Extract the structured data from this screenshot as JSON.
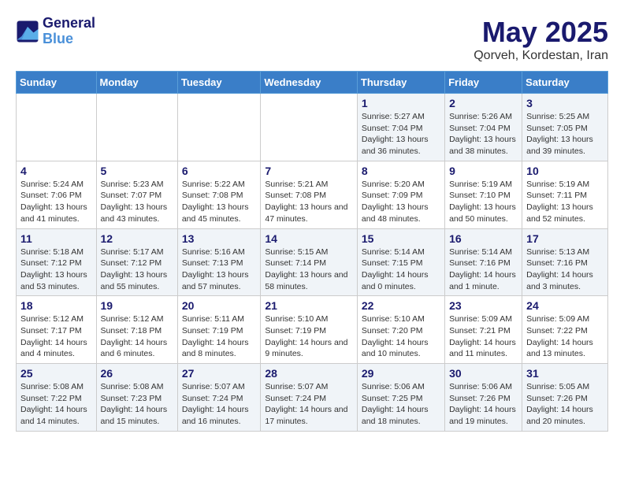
{
  "header": {
    "logo_line1": "General",
    "logo_line2": "Blue",
    "month": "May 2025",
    "location": "Qorveh, Kordestan, Iran"
  },
  "weekdays": [
    "Sunday",
    "Monday",
    "Tuesday",
    "Wednesday",
    "Thursday",
    "Friday",
    "Saturday"
  ],
  "weeks": [
    [
      {
        "day": "",
        "info": ""
      },
      {
        "day": "",
        "info": ""
      },
      {
        "day": "",
        "info": ""
      },
      {
        "day": "",
        "info": ""
      },
      {
        "day": "1",
        "info": "Sunrise: 5:27 AM\nSunset: 7:04 PM\nDaylight: 13 hours\nand 36 minutes."
      },
      {
        "day": "2",
        "info": "Sunrise: 5:26 AM\nSunset: 7:04 PM\nDaylight: 13 hours\nand 38 minutes."
      },
      {
        "day": "3",
        "info": "Sunrise: 5:25 AM\nSunset: 7:05 PM\nDaylight: 13 hours\nand 39 minutes."
      }
    ],
    [
      {
        "day": "4",
        "info": "Sunrise: 5:24 AM\nSunset: 7:06 PM\nDaylight: 13 hours\nand 41 minutes."
      },
      {
        "day": "5",
        "info": "Sunrise: 5:23 AM\nSunset: 7:07 PM\nDaylight: 13 hours\nand 43 minutes."
      },
      {
        "day": "6",
        "info": "Sunrise: 5:22 AM\nSunset: 7:08 PM\nDaylight: 13 hours\nand 45 minutes."
      },
      {
        "day": "7",
        "info": "Sunrise: 5:21 AM\nSunset: 7:08 PM\nDaylight: 13 hours\nand 47 minutes."
      },
      {
        "day": "8",
        "info": "Sunrise: 5:20 AM\nSunset: 7:09 PM\nDaylight: 13 hours\nand 48 minutes."
      },
      {
        "day": "9",
        "info": "Sunrise: 5:19 AM\nSunset: 7:10 PM\nDaylight: 13 hours\nand 50 minutes."
      },
      {
        "day": "10",
        "info": "Sunrise: 5:19 AM\nSunset: 7:11 PM\nDaylight: 13 hours\nand 52 minutes."
      }
    ],
    [
      {
        "day": "11",
        "info": "Sunrise: 5:18 AM\nSunset: 7:12 PM\nDaylight: 13 hours\nand 53 minutes."
      },
      {
        "day": "12",
        "info": "Sunrise: 5:17 AM\nSunset: 7:12 PM\nDaylight: 13 hours\nand 55 minutes."
      },
      {
        "day": "13",
        "info": "Sunrise: 5:16 AM\nSunset: 7:13 PM\nDaylight: 13 hours\nand 57 minutes."
      },
      {
        "day": "14",
        "info": "Sunrise: 5:15 AM\nSunset: 7:14 PM\nDaylight: 13 hours\nand 58 minutes."
      },
      {
        "day": "15",
        "info": "Sunrise: 5:14 AM\nSunset: 7:15 PM\nDaylight: 14 hours\nand 0 minutes."
      },
      {
        "day": "16",
        "info": "Sunrise: 5:14 AM\nSunset: 7:16 PM\nDaylight: 14 hours\nand 1 minute."
      },
      {
        "day": "17",
        "info": "Sunrise: 5:13 AM\nSunset: 7:16 PM\nDaylight: 14 hours\nand 3 minutes."
      }
    ],
    [
      {
        "day": "18",
        "info": "Sunrise: 5:12 AM\nSunset: 7:17 PM\nDaylight: 14 hours\nand 4 minutes."
      },
      {
        "day": "19",
        "info": "Sunrise: 5:12 AM\nSunset: 7:18 PM\nDaylight: 14 hours\nand 6 minutes."
      },
      {
        "day": "20",
        "info": "Sunrise: 5:11 AM\nSunset: 7:19 PM\nDaylight: 14 hours\nand 8 minutes."
      },
      {
        "day": "21",
        "info": "Sunrise: 5:10 AM\nSunset: 7:19 PM\nDaylight: 14 hours\nand 9 minutes."
      },
      {
        "day": "22",
        "info": "Sunrise: 5:10 AM\nSunset: 7:20 PM\nDaylight: 14 hours\nand 10 minutes."
      },
      {
        "day": "23",
        "info": "Sunrise: 5:09 AM\nSunset: 7:21 PM\nDaylight: 14 hours\nand 11 minutes."
      },
      {
        "day": "24",
        "info": "Sunrise: 5:09 AM\nSunset: 7:22 PM\nDaylight: 14 hours\nand 13 minutes."
      }
    ],
    [
      {
        "day": "25",
        "info": "Sunrise: 5:08 AM\nSunset: 7:22 PM\nDaylight: 14 hours\nand 14 minutes."
      },
      {
        "day": "26",
        "info": "Sunrise: 5:08 AM\nSunset: 7:23 PM\nDaylight: 14 hours\nand 15 minutes."
      },
      {
        "day": "27",
        "info": "Sunrise: 5:07 AM\nSunset: 7:24 PM\nDaylight: 14 hours\nand 16 minutes."
      },
      {
        "day": "28",
        "info": "Sunrise: 5:07 AM\nSunset: 7:24 PM\nDaylight: 14 hours\nand 17 minutes."
      },
      {
        "day": "29",
        "info": "Sunrise: 5:06 AM\nSunset: 7:25 PM\nDaylight: 14 hours\nand 18 minutes."
      },
      {
        "day": "30",
        "info": "Sunrise: 5:06 AM\nSunset: 7:26 PM\nDaylight: 14 hours\nand 19 minutes."
      },
      {
        "day": "31",
        "info": "Sunrise: 5:05 AM\nSunset: 7:26 PM\nDaylight: 14 hours\nand 20 minutes."
      }
    ]
  ]
}
